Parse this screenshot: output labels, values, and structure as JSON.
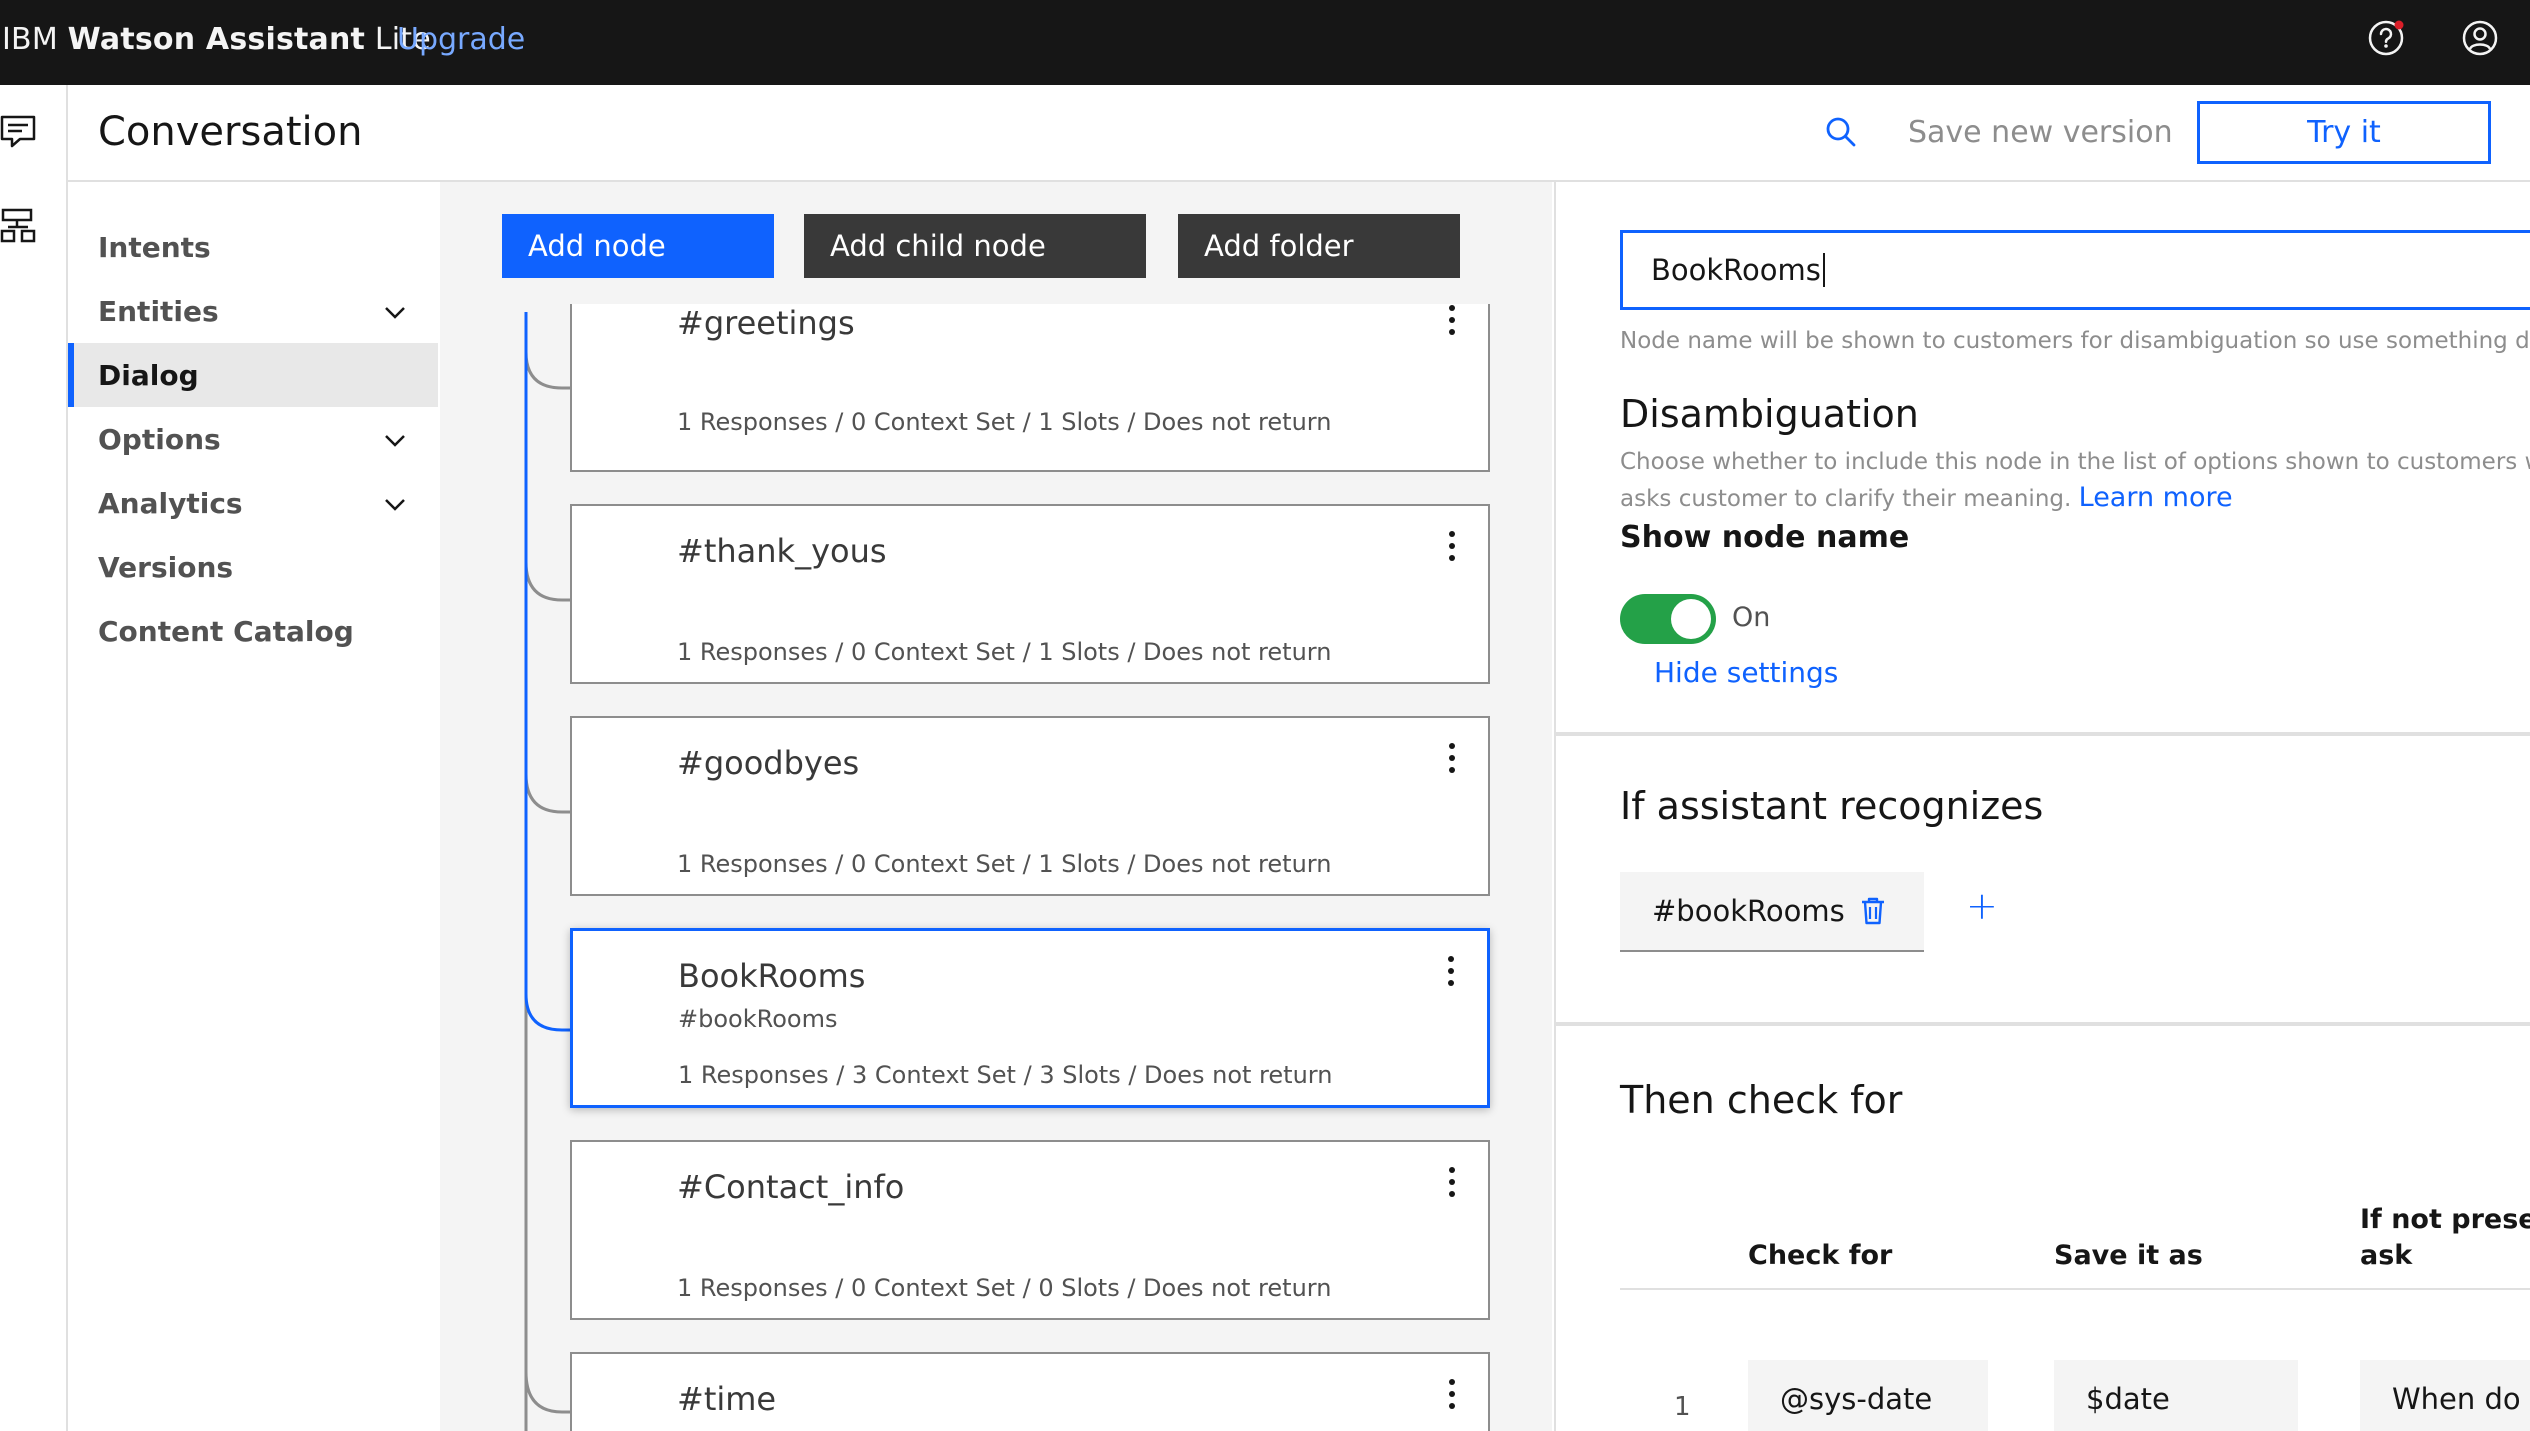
{
  "topbar": {
    "brand_prefix": "IBM ",
    "brand_product": "Watson Assistant",
    "brand_suffix": " Lite",
    "upgrade": "Upgrade",
    "icons": [
      "help-icon",
      "user-avatar-icon"
    ]
  },
  "rail": {
    "icons": [
      "chat-icon",
      "skills-icon"
    ]
  },
  "header": {
    "title": "Conversation",
    "save_version": "Save new version",
    "try_it": "Try it"
  },
  "nav": {
    "items": [
      {
        "label": "Intents",
        "expandable": false
      },
      {
        "label": "Entities",
        "expandable": true
      },
      {
        "label": "Dialog",
        "expandable": false,
        "active": true
      },
      {
        "label": "Options",
        "expandable": true
      },
      {
        "label": "Analytics",
        "expandable": true
      },
      {
        "label": "Versions",
        "expandable": false
      },
      {
        "label": "Content Catalog",
        "expandable": false
      }
    ]
  },
  "toolbar": {
    "add_node": "Add node",
    "add_child_node": "Add child node",
    "add_folder": "Add folder"
  },
  "nodes": [
    {
      "title": "#greetings",
      "meta": "1 Responses / 0 Context Set / 1 Slots / Does not return"
    },
    {
      "title": "#thank_yous",
      "meta": "1 Responses / 0 Context Set / 1 Slots / Does not return"
    },
    {
      "title": "#goodbyes",
      "meta": "1 Responses / 0 Context Set / 1 Slots / Does not return"
    },
    {
      "title": "BookRooms",
      "subtitle": "#bookRooms",
      "meta": "1 Responses / 3 Context Set / 3 Slots / Does not return",
      "selected": true
    },
    {
      "title": "#Contact_info",
      "meta": "1 Responses / 0 Context Set / 0 Slots / Does not return"
    },
    {
      "title": "#time"
    }
  ],
  "panel": {
    "node_name_value": "BookRooms",
    "helper_text": "Node name will be shown to customers for disambiguation so use something des",
    "disambiguation": {
      "title": "Disambiguation",
      "desc_line1": "Choose whether to include this node in the list of options shown to customers wh",
      "desc_line2": "asks customer to clarify their meaning.",
      "learn_more": "Learn more",
      "show_node_name": "Show node name",
      "toggle_state": "On",
      "toggle_on": true,
      "hide_settings": "Hide settings"
    },
    "recognizes": {
      "title": "If assistant recognizes",
      "condition": "#bookRooms",
      "add": "+"
    },
    "check_for": {
      "title": "Then check for",
      "columns": [
        "Check for",
        "Save it as",
        "If not presen",
        "ask"
      ],
      "rows": [
        {
          "num": "1",
          "check": "@sys-date",
          "save_as": "$date",
          "ask": "When do yo"
        }
      ]
    }
  },
  "colors": {
    "accent": "#0f62fe",
    "topbar_bg": "#161616",
    "toggle_on": "#24a148",
    "notification_dot": "#da1e28"
  }
}
